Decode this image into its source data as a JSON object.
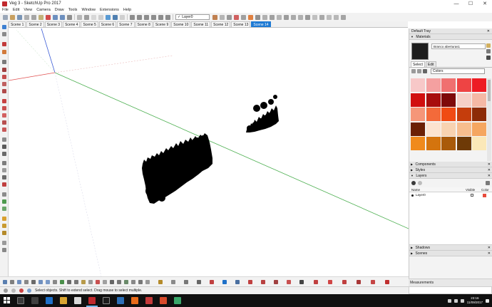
{
  "window": {
    "title": "Veg 3 - SketchUp Pro 2017",
    "controls": {
      "minimize": "—",
      "maximize": "☐",
      "close": "✕"
    }
  },
  "menu": [
    "File",
    "Edit",
    "View",
    "Camera",
    "Draw",
    "Tools",
    "Window",
    "Extensions",
    "Help"
  ],
  "toolbar": {
    "layer_check": "✓",
    "layer_value": "Layer0"
  },
  "scenes": {
    "tabs": [
      "Scene 1",
      "Scene 2",
      "Scene 3",
      "Scene 4",
      "Scene 5",
      "Scene 6",
      "Scene 7",
      "Scene 8",
      "Scene 9",
      "Scene 10",
      "Scene 11",
      "Scene 12",
      "Scene 13",
      "Scene 14"
    ],
    "active_index": 13
  },
  "tray": {
    "title": "Default Tray",
    "close": "✕",
    "materials": {
      "header": "Materials",
      "name": "Branco aberturas1",
      "tabs": [
        "Select",
        "Edit"
      ],
      "collection": "Colors",
      "swatches": [
        "#f7c8c8",
        "#f4a0a0",
        "#f07070",
        "#ee4444",
        "#ed1c24",
        "#d10f0f",
        "#a80d0d",
        "#7f0a0a",
        "#f6cfc6",
        "#f5b8a5",
        "#f59679",
        "#f36a3a",
        "#f04b14",
        "#c53d0c",
        "#8c2b07",
        "#6b2005",
        "#fce3cf",
        "#f8d3b1",
        "#f7be8e",
        "#f5a660",
        "#f08a1c",
        "#d4740e",
        "#a95a0a",
        "#6e3a07",
        "#fbe8b8"
      ]
    },
    "panels": {
      "components": "Components",
      "styles": "Styles",
      "layers": "Layers",
      "shadows": "Shadows",
      "scenes": "Scenes"
    },
    "layers": {
      "columns": {
        "name": "Name",
        "visible": "Visible",
        "color": "Color"
      },
      "rows": [
        {
          "name": "Layer0",
          "color": "#e84b3c"
        }
      ]
    }
  },
  "status": {
    "message": "Select objects. Shift to extend select. Drag mouse to select multiple.",
    "measurements_label": "Measurements"
  },
  "taskbar": {
    "time": "23:16",
    "date": "11/09/2017"
  },
  "colors": {
    "green_axis": "#4caf50",
    "red_axis": "#e05050",
    "blue_axis": "#3b5cd6",
    "active_scene": "#1e7ad4"
  }
}
